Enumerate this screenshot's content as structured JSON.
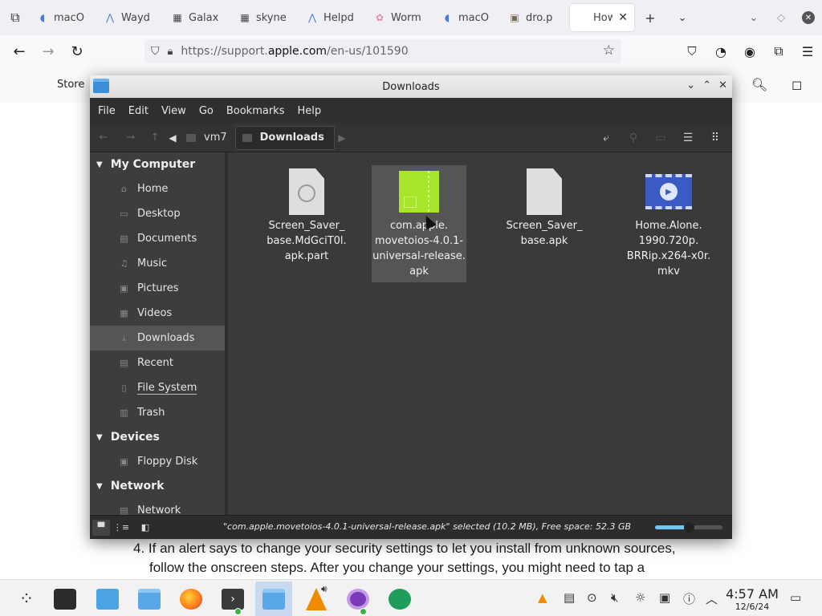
{
  "browser": {
    "tabs": [
      {
        "title": "macO",
        "icon": "document-icon"
      },
      {
        "title": "Wayd",
        "icon": "app-icon"
      },
      {
        "title": "Galax",
        "icon": "grid-icon"
      },
      {
        "title": "skyne",
        "icon": "grid-icon"
      },
      {
        "title": "Helpd",
        "icon": "app-icon"
      },
      {
        "title": "Worm",
        "icon": "flower-icon"
      },
      {
        "title": "macO",
        "icon": "document-icon"
      },
      {
        "title": "dro.p",
        "icon": "image-icon"
      },
      {
        "title": "How",
        "icon": "apple-icon"
      }
    ],
    "url_prefix": "https://support.",
    "url_domain": "apple.com",
    "url_suffix": "/en-us/101590"
  },
  "apple_page": {
    "nav_store": "Store",
    "step_text_line1": "4. If an alert says to change your security settings to let you install from unknown sources,",
    "step_text_line2": "follow the onscreen steps. After you change your settings, you might need to tap a"
  },
  "file_manager": {
    "title": "Downloads",
    "menu": [
      "File",
      "Edit",
      "View",
      "Go",
      "Bookmarks",
      "Help"
    ],
    "breadcrumb": [
      "vm7",
      "Downloads"
    ],
    "sidebar": {
      "my_computer": {
        "label": "My Computer",
        "items": [
          "Home",
          "Desktop",
          "Documents",
          "Music",
          "Pictures",
          "Videos",
          "Downloads",
          "Recent",
          "File System",
          "Trash"
        ]
      },
      "devices": {
        "label": "Devices",
        "items": [
          "Floppy Disk"
        ]
      },
      "network": {
        "label": "Network",
        "items": [
          "Network"
        ]
      }
    },
    "files": [
      {
        "name_lines": [
          "Screen_Saver_",
          "base.MdGciT0l.",
          "apk.part"
        ],
        "type": "partial-file"
      },
      {
        "name_lines": [
          "com.apple.",
          "movetoios-4.0.1-",
          "universal-release.",
          "apk"
        ],
        "type": "apk",
        "selected": true
      },
      {
        "name_lines": [
          "Screen_Saver_",
          "base.apk"
        ],
        "type": "file"
      },
      {
        "name_lines": [
          "Home.Alone.",
          "1990.720p.",
          "BRRip.x264-x0r.",
          "mkv"
        ],
        "type": "video"
      }
    ],
    "status": "\"com.apple.movetoios-4.0.1-universal-release.apk\" selected (10.2 MB), Free space: 52.3 GB",
    "zoom_level": 0.5
  },
  "taskbar": {
    "time": "4:57 AM",
    "date": "12/6/24"
  }
}
